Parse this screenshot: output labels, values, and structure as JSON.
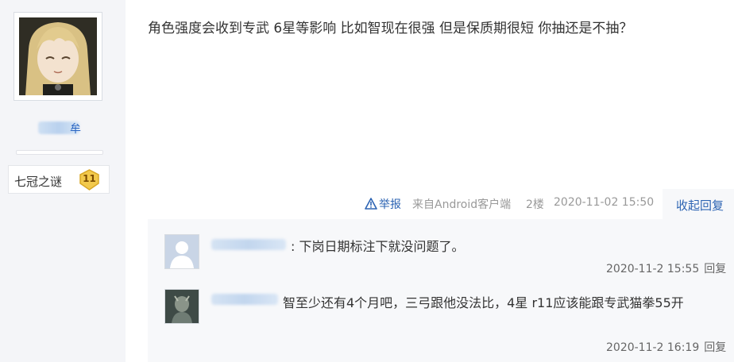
{
  "sidebar": {
    "username_suffix": "牟",
    "badge": {
      "name": "七冠之谜",
      "level": "11"
    }
  },
  "post": {
    "text": "角色强度会收到专武 6星等影响 比如智现在很强 但是保质期很短 你抽还是不抽？",
    "report_label": "举报",
    "source": "来自Android客户端",
    "floor": "2楼",
    "time": "2020-11-02 15:50",
    "collapse_label": "收起回复"
  },
  "replies": [
    {
      "text": ": 下岗日期标注下就没问题了。",
      "time": "2020-11-2 15:55",
      "reply_label": "回复"
    },
    {
      "text": "智至少还有4个月吧，三弓跟他没法比，4星 r11应该能跟专武猫拳55开",
      "time": "2020-11-2 16:19",
      "reply_label": "回复"
    }
  ],
  "colors": {
    "link": "#2d64b3",
    "sidebar_bg": "#f4f5f8",
    "reply_bg": "#f7f8fa",
    "badge_gold": "#f2c94c"
  }
}
